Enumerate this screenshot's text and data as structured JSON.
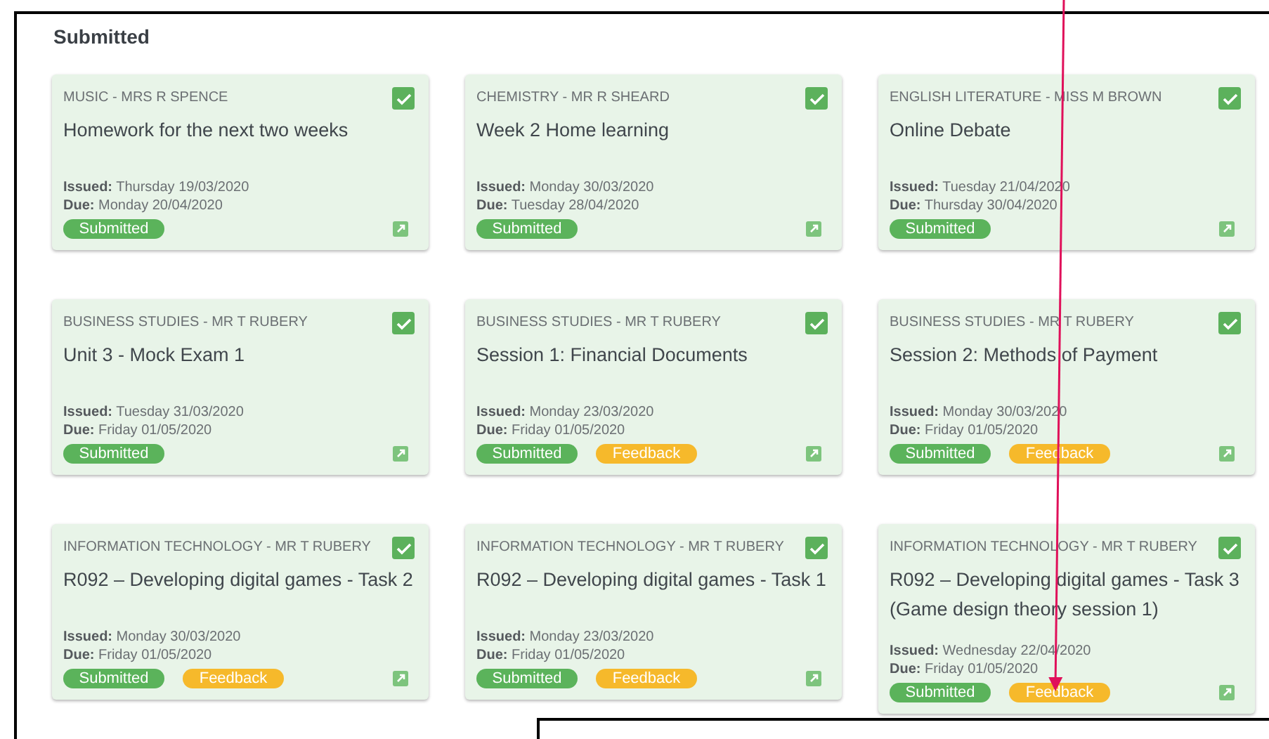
{
  "heading": "Submitted",
  "cards": [
    {
      "subject": "MUSIC - MRS R SPENCE",
      "title": "Homework for the next two weeks",
      "issued": "**Issued:** Thursday 19/03/2020",
      "due": "**Due:** Monday 20/04/2020",
      "checked": true,
      "badges": [
        {
          "label": "Submitted",
          "kind": "submitted"
        }
      ]
    },
    {
      "subject": "CHEMISTRY - MR R SHEARD",
      "title": "Week 2 Home learning",
      "issued": "**Issued:** Monday 30/03/2020",
      "due": "**Due:** Tuesday 28/04/2020",
      "checked": true,
      "badges": [
        {
          "label": "Submitted",
          "kind": "submitted"
        }
      ]
    },
    {
      "subject": "ENGLISH LITERATURE - MISS M BROWN",
      "title": "Online Debate",
      "issued": "**Issued:** Tuesday 21/04/2020",
      "due": "**Due:** Thursday 30/04/2020",
      "checked": true,
      "badges": [
        {
          "label": "Submitted",
          "kind": "submitted"
        }
      ]
    },
    {
      "subject": "BUSINESS STUDIES - MR T RUBERY",
      "title": "Unit 3 - Mock Exam 1",
      "issued": "**Issued:** Tuesday 31/03/2020",
      "due": "**Due:** Friday 01/05/2020",
      "checked": true,
      "badges": [
        {
          "label": "Submitted",
          "kind": "submitted"
        }
      ]
    },
    {
      "subject": "BUSINESS STUDIES - MR T RUBERY",
      "title": "Session 1: Financial Documents",
      "issued": "**Issued:** Monday 23/03/2020",
      "due": "**Due:** Friday 01/05/2020",
      "checked": true,
      "badges": [
        {
          "label": "Submitted",
          "kind": "submitted"
        },
        {
          "label": "Feedback",
          "kind": "feedback"
        }
      ]
    },
    {
      "subject": "BUSINESS STUDIES - MR T RUBERY",
      "title": "Session 2: Methods of Payment",
      "issued": "**Issued:** Monday 30/03/2020",
      "due": "**Due:** Friday 01/05/2020",
      "checked": true,
      "badges": [
        {
          "label": "Submitted",
          "kind": "submitted"
        },
        {
          "label": "Feedback",
          "kind": "feedback"
        }
      ]
    },
    {
      "subject": "INFORMATION TECHNOLOGY - MR T RUBERY",
      "title": "R092 – Developing digital games - Task 2",
      "issued": "**Issued:** Monday 30/03/2020",
      "due": "**Due:** Friday 01/05/2020",
      "checked": true,
      "badges": [
        {
          "label": "Submitted",
          "kind": "submitted"
        },
        {
          "label": "Feedback",
          "kind": "feedback"
        }
      ]
    },
    {
      "subject": "INFORMATION TECHNOLOGY - MR T RUBERY",
      "title": "R092 – Developing digital games - Task 1",
      "issued": "**Issued:** Monday 23/03/2020",
      "due": "**Due:** Friday 01/05/2020",
      "checked": true,
      "badges": [
        {
          "label": "Submitted",
          "kind": "submitted"
        },
        {
          "label": "Feedback",
          "kind": "feedback"
        }
      ]
    },
    {
      "subject": "INFORMATION TECHNOLOGY - MR T RUBERY",
      "title": "R092 – Developing digital games - Task 3 (Game design theory session 1)",
      "issued": "**Issued:** Wednesday 22/04/2020",
      "due": "**Due:** Friday 01/05/2020",
      "checked": true,
      "badges": [
        {
          "label": "Submitted",
          "kind": "submitted"
        },
        {
          "label": "Feedback",
          "kind": "feedback"
        }
      ]
    }
  ]
}
